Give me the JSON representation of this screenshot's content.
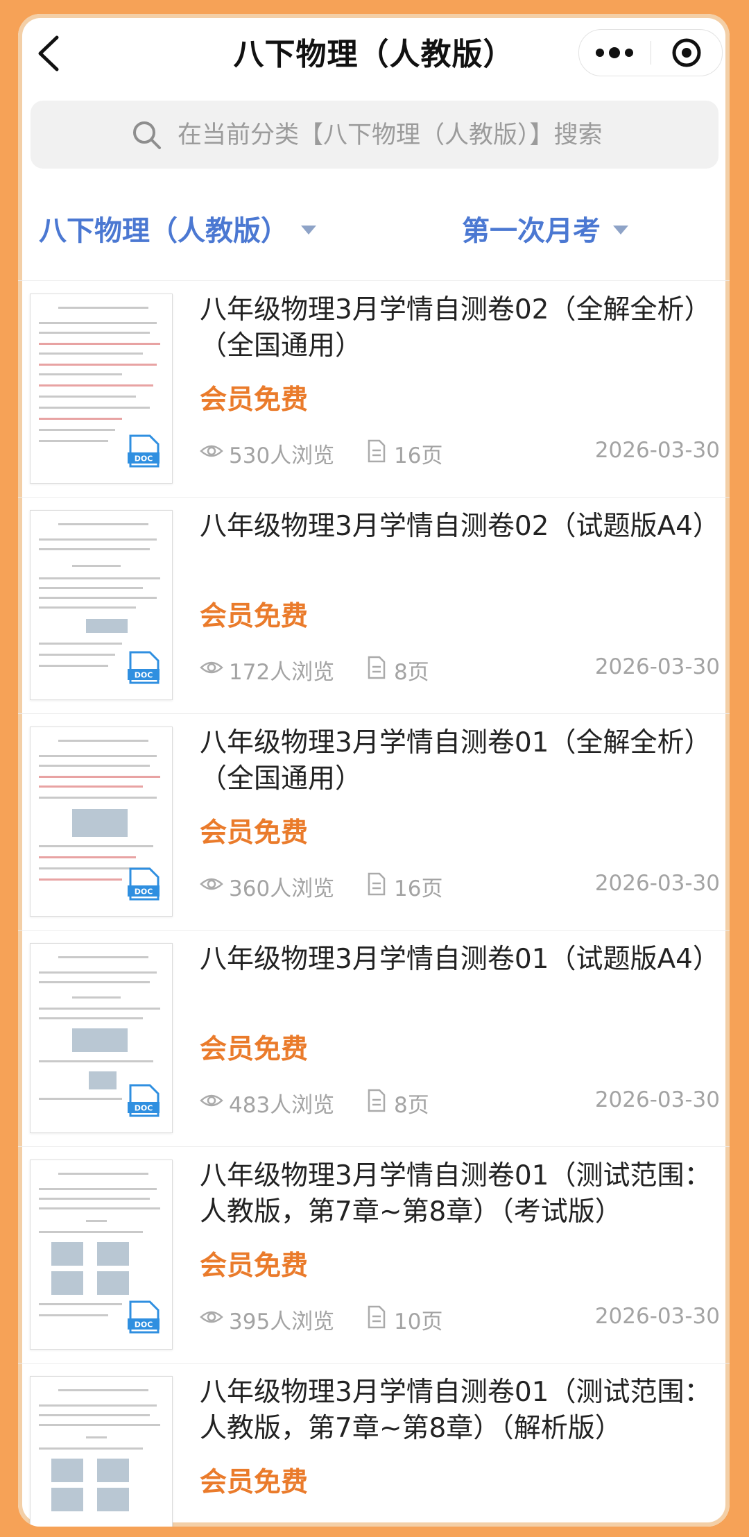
{
  "nav": {
    "title": "八下物理（人教版）",
    "back_icon": "chevron-left-icon",
    "more_icon": "more-dots-icon",
    "close_icon": "target-circle-icon"
  },
  "search": {
    "placeholder": "在当前分类【八下物理（人教版）】搜索",
    "icon": "search-icon"
  },
  "filters": [
    {
      "label": "八下物理（人教版）"
    },
    {
      "label": "第一次月考"
    }
  ],
  "colors": {
    "accent": "#4b78d2",
    "price": "#ea7b2b",
    "frame": "#f6a257",
    "doc_badge": "#2f8fe0"
  },
  "items": [
    {
      "title": "八年级物理3月学情自测卷02（全解全析）（全国通用）",
      "price": "会员免费",
      "views": "530人浏览",
      "pages": "16页",
      "date": "2026-03-30",
      "badge": "DOC"
    },
    {
      "title": "八年级物理3月学情自测卷02（试题版A4）",
      "price": "会员免费",
      "views": "172人浏览",
      "pages": "8页",
      "date": "2026-03-30",
      "badge": "DOC"
    },
    {
      "title": "八年级物理3月学情自测卷01（全解全析）（全国通用）",
      "price": "会员免费",
      "views": "360人浏览",
      "pages": "16页",
      "date": "2026-03-30",
      "badge": "DOC"
    },
    {
      "title": "八年级物理3月学情自测卷01（试题版A4）",
      "price": "会员免费",
      "views": "483人浏览",
      "pages": "8页",
      "date": "2026-03-30",
      "badge": "DOC"
    },
    {
      "title": "八年级物理3月学情自测卷01（测试范围：人教版，第7章~第8章）（考试版）",
      "price": "会员免费",
      "views": "395人浏览",
      "pages": "10页",
      "date": "2026-03-30",
      "badge": "DOC"
    },
    {
      "title": "八年级物理3月学情自测卷01（测试范围：人教版，第7章~第8章）（解析版）",
      "price": "会员免费",
      "views": "",
      "pages": "",
      "date": "",
      "badge": ""
    }
  ]
}
